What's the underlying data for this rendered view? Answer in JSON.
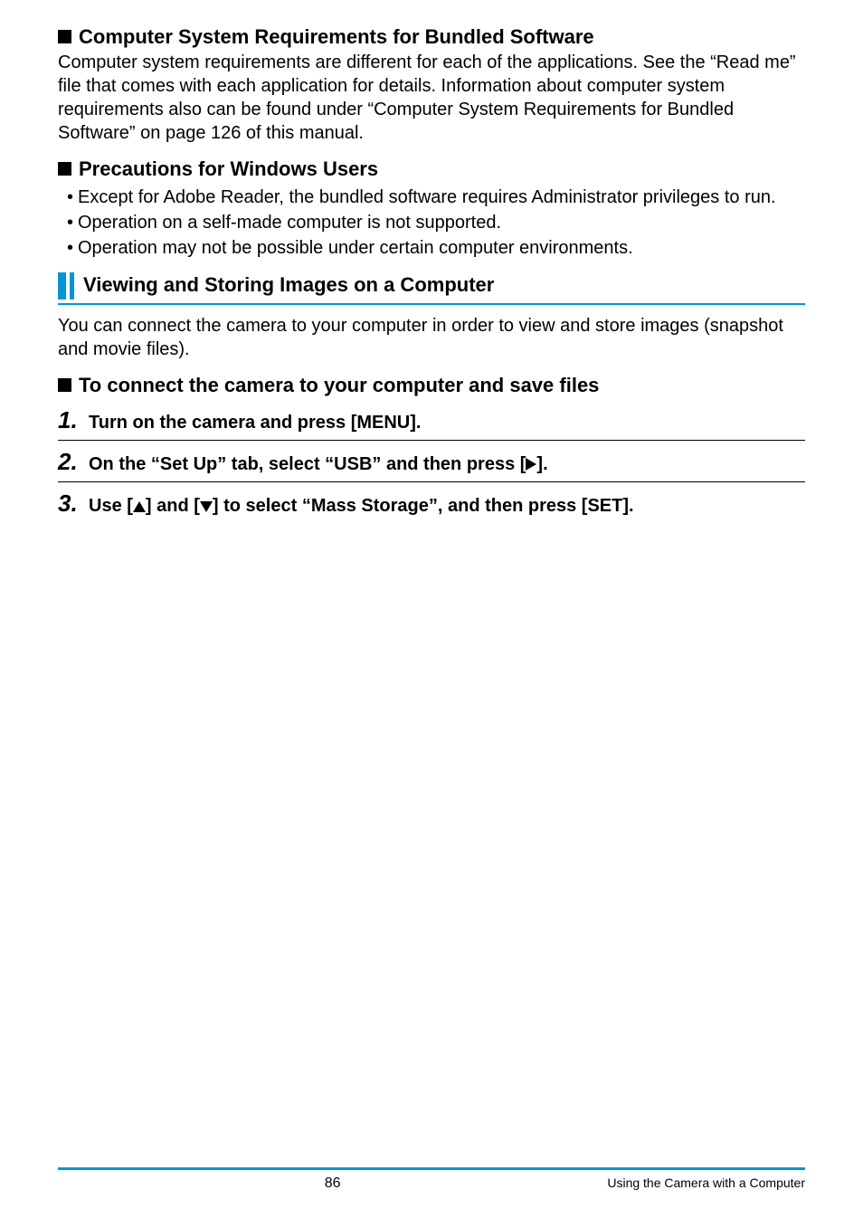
{
  "sections": {
    "bundled_software": {
      "title": "Computer System Requirements for Bundled Software",
      "body": "Computer system requirements are different for each of the applications. See the “Read me” file that comes with each application for details. Information about computer system requirements also can be found under “Computer System Requirements for Bundled Software” on page 126 of this manual."
    },
    "precautions": {
      "title": "Precautions for Windows Users",
      "bullets": [
        "Except for Adobe Reader, the bundled software requires Administrator privileges to run.",
        "Operation on a self-made computer is not supported.",
        "Operation may not be possible under certain computer environments."
      ]
    },
    "viewing": {
      "title": "Viewing and Storing Images on a Computer",
      "intro": "You can connect the camera to your computer in order to view and store images (snapshot and movie files).",
      "connect_title": "To connect the camera to your computer and save files",
      "steps": {
        "s1": {
          "num": "1.",
          "text": "Turn on the camera and press [MENU]."
        },
        "s2": {
          "num": "2.",
          "pre": "On the “Set Up” tab, select “USB” and then press [",
          "post": "]."
        },
        "s3": {
          "num": "3.",
          "pre": "Use [",
          "mid": "] and [",
          "post": "] to select “Mass Storage”, and then press [SET]."
        }
      }
    }
  },
  "footer": {
    "page_number": "86",
    "chapter": "Using the Camera with a Computer"
  }
}
